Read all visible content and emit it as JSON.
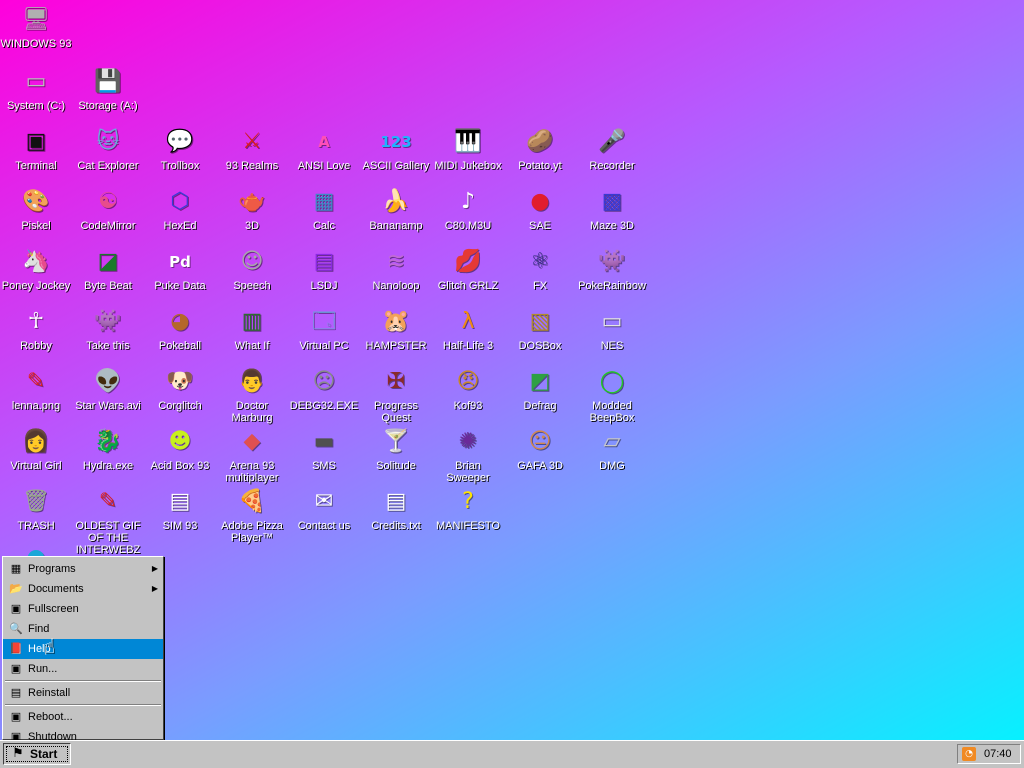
{
  "desktop": {
    "icons": [
      {
        "label": "WINDOWS 93",
        "glyph": "🖥",
        "color": "#b0b0b0"
      },
      {
        "label": "System (C:)",
        "glyph": "▭",
        "color": "#bdbdbd"
      },
      {
        "label": "Storage (A:)",
        "glyph": "💾",
        "color": "#cfcfcf"
      },
      {
        "label": "Terminal",
        "glyph": "▣",
        "color": "#111111"
      },
      {
        "label": "Cat Explorer",
        "glyph": "🐱",
        "color": "#6fa8dc"
      },
      {
        "label": "Trollbox",
        "glyph": "💬",
        "color": "#ffd21f"
      },
      {
        "label": "93 Realms",
        "glyph": "⚔",
        "color": "#d81b1b"
      },
      {
        "label": "ANSI Love",
        "glyph": "A",
        "color": "#ff4fb6"
      },
      {
        "label": "ASCII Gallery",
        "glyph": "123",
        "color": "#1fb3ff"
      },
      {
        "label": "MIDI Jukebox",
        "glyph": "🎹",
        "color": "#f0f0f0"
      },
      {
        "label": "Potato.yt",
        "glyph": "🥔",
        "color": "#c9924a"
      },
      {
        "label": "Recorder",
        "glyph": "🎤",
        "color": "#8e8e8e"
      },
      {
        "label": "Piskel",
        "glyph": "🎨",
        "color": "#f2c28a"
      },
      {
        "label": "CodeMirror",
        "glyph": "☯",
        "color": "#e74c8c"
      },
      {
        "label": "HexEd",
        "glyph": "⬡",
        "color": "#3b3bd6"
      },
      {
        "label": "3D",
        "glyph": "🫖",
        "color": "#e58bd1"
      },
      {
        "label": "Calc",
        "glyph": "▦",
        "color": "#3f88c5"
      },
      {
        "label": "Bananamp",
        "glyph": "🍌",
        "color": "#ffd400"
      },
      {
        "label": "C80.M3U",
        "glyph": "♪",
        "color": "#ffffff"
      },
      {
        "label": "SAE",
        "glyph": "●",
        "color": "#e11d2e"
      },
      {
        "label": "Maze 3D",
        "glyph": "▩",
        "color": "#3a3ad0"
      },
      {
        "label": "Poney Jockey",
        "glyph": "🦄",
        "color": "#b064d8"
      },
      {
        "label": "Byte Beat",
        "glyph": "◪",
        "color": "#1a7a2a"
      },
      {
        "label": "Puke Data",
        "glyph": "Pd",
        "color": "#ffffff"
      },
      {
        "label": "Speech",
        "glyph": "☺",
        "color": "#a8a8a8"
      },
      {
        "label": "LSDJ",
        "glyph": "▤",
        "color": "#8a2be2"
      },
      {
        "label": "Nanoloop",
        "glyph": "≋",
        "color": "#c06bd6"
      },
      {
        "label": "Glitch GRLZ",
        "glyph": "💋",
        "color": "#e6194b"
      },
      {
        "label": "FX",
        "glyph": "⚛",
        "color": "#2a2a7a"
      },
      {
        "label": "PokeRainbow",
        "glyph": "👾",
        "color": "#3a7a3a"
      },
      {
        "label": "Robby",
        "glyph": "☥",
        "color": "#ffffff"
      },
      {
        "label": "Take this",
        "glyph": "👾",
        "color": "#ff7b2e"
      },
      {
        "label": "Pokeball",
        "glyph": "◕",
        "color": "#b5672a"
      },
      {
        "label": "What If",
        "glyph": "▥",
        "color": "#2d6e2d"
      },
      {
        "label": "Virtual PC",
        "glyph": "🗔",
        "color": "#6b9fd8"
      },
      {
        "label": "HAMPSTER",
        "glyph": "🐹",
        "color": "#d8d8d8"
      },
      {
        "label": "Half-Life 3",
        "glyph": "λ",
        "color": "#f08a10"
      },
      {
        "label": "DOSBox",
        "glyph": "▧",
        "color": "#b08a2a"
      },
      {
        "label": "NES",
        "glyph": "▭",
        "color": "#e5e5e5"
      },
      {
        "label": "lenna.png",
        "glyph": "✎",
        "color": "#e02020"
      },
      {
        "label": "Star Wars.avi",
        "glyph": "👽",
        "color": "#4caf50"
      },
      {
        "label": "Corglitch",
        "glyph": "🐶",
        "color": "#e3a05a"
      },
      {
        "label": "Doctor Marburg",
        "glyph": "👨",
        "color": "#d84a4a"
      },
      {
        "label": "DEBG32.EXE",
        "glyph": "☹",
        "color": "#8a8a8a"
      },
      {
        "label": "Progress Quest",
        "glyph": "✠",
        "color": "#8a2a2a"
      },
      {
        "label": "Kof93",
        "glyph": "😠",
        "color": "#c9892a"
      },
      {
        "label": "Defrag",
        "glyph": "◩",
        "color": "#2ea043"
      },
      {
        "label": "Modded BeepBox",
        "glyph": "◯",
        "color": "#21c821"
      },
      {
        "label": "Virtual Girl",
        "glyph": "👩",
        "color": "#f2b8a0"
      },
      {
        "label": "Hydra.exe",
        "glyph": "🐉",
        "color": "#2e8b57"
      },
      {
        "label": "Acid Box 93",
        "glyph": "☻",
        "color": "#c8f01e"
      },
      {
        "label": "Arena 93 multiplayer",
        "glyph": "◆",
        "color": "#e05050"
      },
      {
        "label": "SMS",
        "glyph": "▬",
        "color": "#505050"
      },
      {
        "label": "Solitude",
        "glyph": "🍸",
        "color": "#3fae52"
      },
      {
        "label": "Brian Sweeper",
        "glyph": "✺",
        "color": "#6a2a9a"
      },
      {
        "label": "GAFA 3D",
        "glyph": "😐",
        "color": "#d08850"
      },
      {
        "label": "DMG",
        "glyph": "▱",
        "color": "#c8c8c8"
      },
      {
        "label": "TRASH",
        "glyph": "🗑",
        "color": "#9ab08a"
      },
      {
        "label": "OLDEST GIF OF THE INTERWEBZ",
        "glyph": "✎",
        "color": "#e02020"
      },
      {
        "label": "SIM 93",
        "glyph": "▤",
        "color": "#ffffff"
      },
      {
        "label": "Adobe Pizza Player™",
        "glyph": "🍕",
        "color": "#e88a2a"
      },
      {
        "label": "Contact us",
        "glyph": "✉",
        "color": "#ffffff"
      },
      {
        "label": "Credits.txt",
        "glyph": "▤",
        "color": "#ffffff"
      },
      {
        "label": "MANIFESTO",
        "glyph": "?",
        "color": "#ffe400"
      },
      {
        "label": "",
        "glyph": "◓",
        "color": "#1aa7d8"
      }
    ]
  },
  "start_menu": {
    "items": [
      {
        "label": "Programs",
        "icon": "programs-icon",
        "glyph": "▦",
        "has_submenu": true
      },
      {
        "label": "Documents",
        "icon": "documents-icon",
        "glyph": "📂",
        "has_submenu": true
      },
      {
        "label": "Fullscreen",
        "icon": "fullscreen-icon",
        "glyph": "▣",
        "has_submenu": false
      },
      {
        "label": "Find",
        "icon": "find-icon",
        "glyph": "🔍",
        "has_submenu": false
      },
      {
        "label": "Help",
        "icon": "help-icon",
        "glyph": "📕",
        "has_submenu": false,
        "highlight": true
      },
      {
        "label": "Run...",
        "icon": "run-icon",
        "glyph": "▣",
        "has_submenu": false
      },
      {
        "label": "Reinstall",
        "icon": "reinstall-icon",
        "glyph": "▤",
        "has_submenu": false
      },
      {
        "label": "Reboot...",
        "icon": "reboot-icon",
        "glyph": "▣",
        "has_submenu": false
      },
      {
        "label": "Shutdown",
        "icon": "shutdown-icon",
        "glyph": "▣",
        "has_submenu": false
      }
    ]
  },
  "taskbar": {
    "start_label": "Start",
    "clock": "07:40"
  }
}
